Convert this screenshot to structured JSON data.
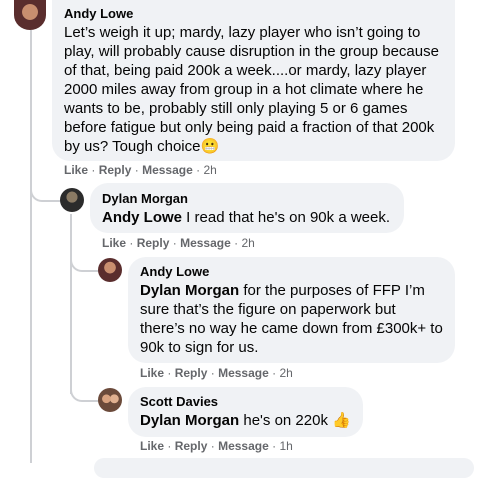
{
  "comments": [
    {
      "author": "Andy Lowe",
      "text": "Let’s weigh it up; mardy, lazy player who isn’t going to play, will probably cause disruption in the group because of that, being paid 200k a week....or mardy, lazy player 2000 miles away from group in a hot climate where he wants to be, probably still only playing 5 or 6 games before fatigue but only being paid a fraction of that 200k by us? Tough choice",
      "emoji": "😬",
      "time": "2h"
    },
    {
      "author": "Dylan Morgan",
      "mention": "Andy Lowe",
      "text": " I read that he's on 90k a week.",
      "time": "2h"
    },
    {
      "author": "Andy Lowe",
      "mention": "Dylan Morgan",
      "text": " for the purposes of FFP I’m sure that’s the figure on paperwork but there’s no way he came down from £300k+ to 90k to sign for us.",
      "time": "2h"
    },
    {
      "author": "Scott Davies",
      "mention": "Dylan Morgan",
      "text": " he's on 220k ",
      "emoji": "👍",
      "time": "1h"
    }
  ],
  "actions": {
    "like": "Like",
    "reply": "Reply",
    "message": "Message",
    "sep": "·"
  },
  "colors": {
    "bubble": "#f0f2f5",
    "meta": "#65676b",
    "line": "#ced0d4"
  }
}
